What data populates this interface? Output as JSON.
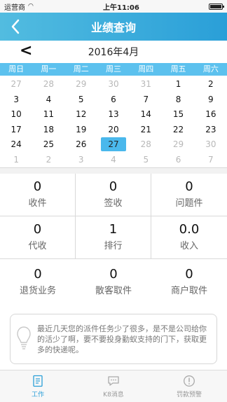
{
  "status_bar": {
    "carrier": "运营商",
    "time": "上午11:06"
  },
  "nav": {
    "title": "业绩查询",
    "back_icon": "chevron-left-icon"
  },
  "calendar": {
    "prev_label": "<",
    "month_label": "2016年4月",
    "weekdays": [
      "周日",
      "周一",
      "周二",
      "周三",
      "周四",
      "周五",
      "周六"
    ],
    "weeks": [
      [
        {
          "d": "27",
          "m": true
        },
        {
          "d": "28",
          "m": true
        },
        {
          "d": "29",
          "m": true
        },
        {
          "d": "30",
          "m": true
        },
        {
          "d": "31",
          "m": true
        },
        {
          "d": "1"
        },
        {
          "d": "2"
        }
      ],
      [
        {
          "d": "3"
        },
        {
          "d": "4"
        },
        {
          "d": "5"
        },
        {
          "d": "6"
        },
        {
          "d": "7"
        },
        {
          "d": "8"
        },
        {
          "d": "9"
        }
      ],
      [
        {
          "d": "10"
        },
        {
          "d": "11"
        },
        {
          "d": "12"
        },
        {
          "d": "13"
        },
        {
          "d": "14"
        },
        {
          "d": "15"
        },
        {
          "d": "16"
        }
      ],
      [
        {
          "d": "17"
        },
        {
          "d": "18"
        },
        {
          "d": "19"
        },
        {
          "d": "20"
        },
        {
          "d": "21"
        },
        {
          "d": "22"
        },
        {
          "d": "23"
        }
      ],
      [
        {
          "d": "24"
        },
        {
          "d": "25"
        },
        {
          "d": "26"
        },
        {
          "d": "27",
          "sel": true
        },
        {
          "d": "28",
          "m": true
        },
        {
          "d": "29",
          "m": true
        },
        {
          "d": "30",
          "m": true
        }
      ],
      [
        {
          "d": "1",
          "m": true
        },
        {
          "d": "2",
          "m": true
        },
        {
          "d": "3",
          "m": true
        },
        {
          "d": "4",
          "m": true
        },
        {
          "d": "5",
          "m": true
        },
        {
          "d": "6",
          "m": true
        },
        {
          "d": "7",
          "m": true
        }
      ]
    ],
    "accent_color": "#4ab8ec"
  },
  "stats": [
    {
      "value": "0",
      "label": "收件"
    },
    {
      "value": "0",
      "label": "签收"
    },
    {
      "value": "0",
      "label": "问题件"
    },
    {
      "value": "0",
      "label": "代收"
    },
    {
      "value": "1",
      "label": "排行"
    },
    {
      "value": "0.0",
      "label": "收入"
    }
  ],
  "stats_row3": [
    {
      "value": "0",
      "label": "退货业务"
    },
    {
      "value": "0",
      "label": "散客取件"
    },
    {
      "value": "0",
      "label": "商户取件"
    }
  ],
  "tip": {
    "icon": "lightbulb-icon",
    "text": "最近几天您的派件任务少了很多，是不是公司给你的活少了啊，要不要投身勤蚁支持的门下，获取更多的快递呢。"
  },
  "tabs": [
    {
      "label": "工作",
      "icon": "document-icon",
      "active": true
    },
    {
      "label": "K8消息",
      "icon": "chat-icon",
      "active": false
    },
    {
      "label": "罚款预警",
      "icon": "warning-badge-icon",
      "active": false
    }
  ]
}
